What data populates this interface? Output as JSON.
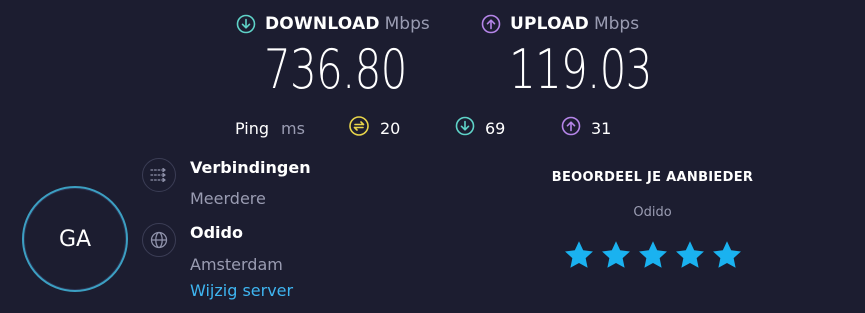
{
  "download": {
    "label": "DOWNLOAD",
    "unit": "Mbps",
    "value": "736.80",
    "icon": "arrow-down-circle-icon",
    "color": "#5fd3c8"
  },
  "upload": {
    "label": "UPLOAD",
    "unit": "Mbps",
    "value": "119.03",
    "icon": "arrow-up-circle-icon",
    "color": "#b585e8"
  },
  "ping": {
    "label": "Ping",
    "unit": "ms",
    "idle": {
      "value": "20",
      "icon": "ping-idle-icon",
      "color": "#e8d54a"
    },
    "down": {
      "value": "69",
      "icon": "ping-download-icon",
      "color": "#5fd3c8"
    },
    "up": {
      "value": "31",
      "icon": "ping-upload-icon",
      "color": "#b585e8"
    }
  },
  "provider": {
    "initials": "GA"
  },
  "connections": {
    "title": "Verbindingen",
    "value": "Meerdere",
    "icon": "connections-icon"
  },
  "server": {
    "title": "Odido",
    "location": "Amsterdam",
    "change_link": "Wijzig server",
    "icon": "globe-icon"
  },
  "rating": {
    "title": "BEOORDEEL JE AANBIEDER",
    "provider": "Odido",
    "stars_filled": 5,
    "stars_total": 5,
    "star_color": "#1ab2f0"
  }
}
